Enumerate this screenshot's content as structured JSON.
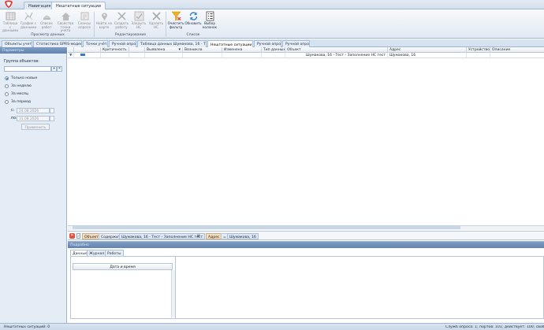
{
  "nav_tabs": [
    "Навигация",
    "Нештатные ситуации"
  ],
  "ribbon": {
    "buttons": [
      {
        "label": "Таблица с данными",
        "icon": "table-icon",
        "enabled": false
      },
      {
        "label": "График с данными",
        "icon": "chart-icon",
        "enabled": false
      },
      {
        "label": "Список работ",
        "icon": "list-icon",
        "enabled": false
      },
      {
        "label": "Свойства точки учета",
        "icon": "house-icon",
        "enabled": false
      },
      {
        "label": "Сеансы опроса",
        "icon": "session-icon",
        "enabled": false
      },
      {
        "label": "Найти на карте",
        "icon": "map-pin-icon",
        "enabled": false
      },
      {
        "label": "Создать работу",
        "icon": "tools-icon",
        "enabled": false
      },
      {
        "label": "Закрыть НС",
        "icon": "check-icon",
        "enabled": false
      },
      {
        "label": "Удалить НС",
        "icon": "delete-icon",
        "enabled": false
      },
      {
        "label": "Очистить фильтр",
        "icon": "clear-filter-icon",
        "enabled": true
      },
      {
        "label": "Обновить",
        "icon": "refresh-icon",
        "enabled": true
      },
      {
        "label": "Выбор колонок",
        "icon": "columns-icon",
        "enabled": true
      }
    ],
    "groups": [
      "Просмотр данных",
      "Редактирование",
      "Список"
    ]
  },
  "doc_tabs": [
    "Объекты учета",
    "Статистика GPRS-модемов",
    "Точки учёта",
    "Ручной опрос",
    "Таблица данных Шумакова, 16 - Тепл...",
    "Нештатные ситуации",
    "Ручной опрос",
    "Ручной опрос"
  ],
  "left_panel": {
    "title": "Параметры",
    "group_label": "Группа объектов:",
    "group_value": "",
    "radios": [
      "Только новые",
      "За неделю",
      "За месяц",
      "За период"
    ],
    "selected": "Только новые",
    "from_label": "с:",
    "from_value": "24.08.2026",
    "to_label": "по:",
    "to_value": "31.08.2026",
    "apply": "Применить"
  },
  "grid": {
    "columns": [
      "",
      "",
      "Критичность",
      "",
      "Выявлена",
      "",
      "Возникла",
      "Изменена",
      "Тип данных",
      "Объект",
      "Адрес",
      "Устройство",
      "Описание"
    ],
    "filter_object": "Шумакова, 16 - Тест - Заполнение НС тест",
    "filter_address": "Шумакова, 16"
  },
  "filter_bar": {
    "chips": [
      "Объект",
      "Содержит",
      "Шумакова, 16 - Тест - Заполнение НС тест",
      "И",
      "Адрес",
      "=",
      "Шумакова, 16"
    ]
  },
  "details": {
    "title": "Подробно",
    "tabs": [
      "Данные",
      "Журнал",
      "Работы"
    ],
    "column": "Дата и время"
  },
  "status": {
    "left": "Нештатных ситуаций: 0",
    "right": "Служб опроса: 1; портов: 101; действует: 100; свободно"
  }
}
